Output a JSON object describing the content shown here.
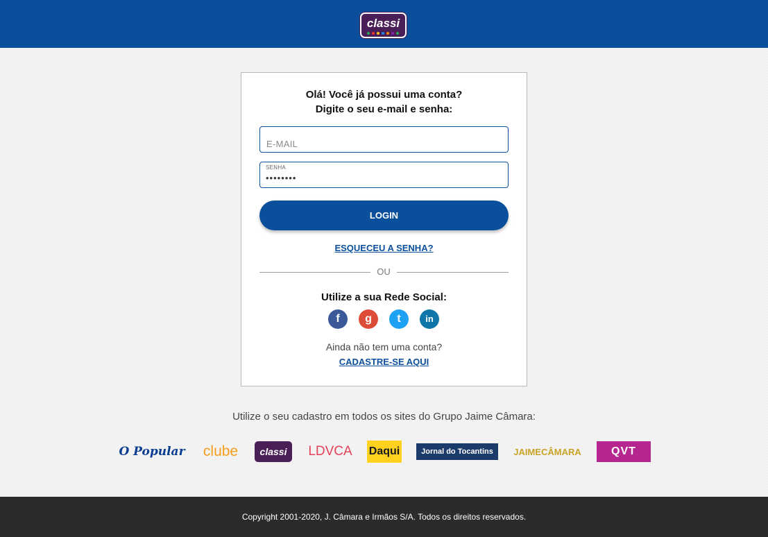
{
  "header": {
    "brand_logo_text": "classi",
    "brand_colors": [
      "#0a4f9c",
      "#4a1f58"
    ],
    "logo_dot_colors": [
      "#2aa84a",
      "#e53935",
      "#f5c518",
      "#1e88e5",
      "#fb8c00",
      "#8e24aa"
    ]
  },
  "login": {
    "greeting_line1": "Olá! Você já possui uma conta?",
    "greeting_line2": "Digite o seu e-mail e senha:",
    "email": {
      "placeholder": "E-MAIL",
      "value": ""
    },
    "password": {
      "label": "SENHA",
      "value": "••••••••"
    },
    "login_button": "LOGIN",
    "forgot_password": "ESQUECEU A SENHA?",
    "divider": "OU",
    "social_title": "Utilize a sua Rede Social:",
    "social": [
      {
        "name": "facebook-icon",
        "glyph": "f",
        "color": "#3b5998"
      },
      {
        "name": "google-plus-icon",
        "glyph": "g",
        "color": "#dd4b39"
      },
      {
        "name": "twitter-icon",
        "glyph": "t",
        "color": "#1da1f2"
      },
      {
        "name": "linkedin-icon",
        "glyph": "in",
        "color": "#0e76a8"
      }
    ],
    "no_account": "Ainda não tem uma conta?",
    "register": "CADASTRE-SE AQUI"
  },
  "group": {
    "text": "Utilize o seu cadastro em todos os sites do Grupo Jaime Câmara:",
    "logos": [
      "O Popular",
      "clube",
      "classi",
      "LDVCA",
      "Daqui",
      "Jornal do Tocantins",
      "JAIMECÂMARA",
      "QVT"
    ]
  },
  "footer": {
    "copyright": "Copyright 2001-2020, J. Câmara e Irmãos S/A. Todos os direitos reservados."
  }
}
